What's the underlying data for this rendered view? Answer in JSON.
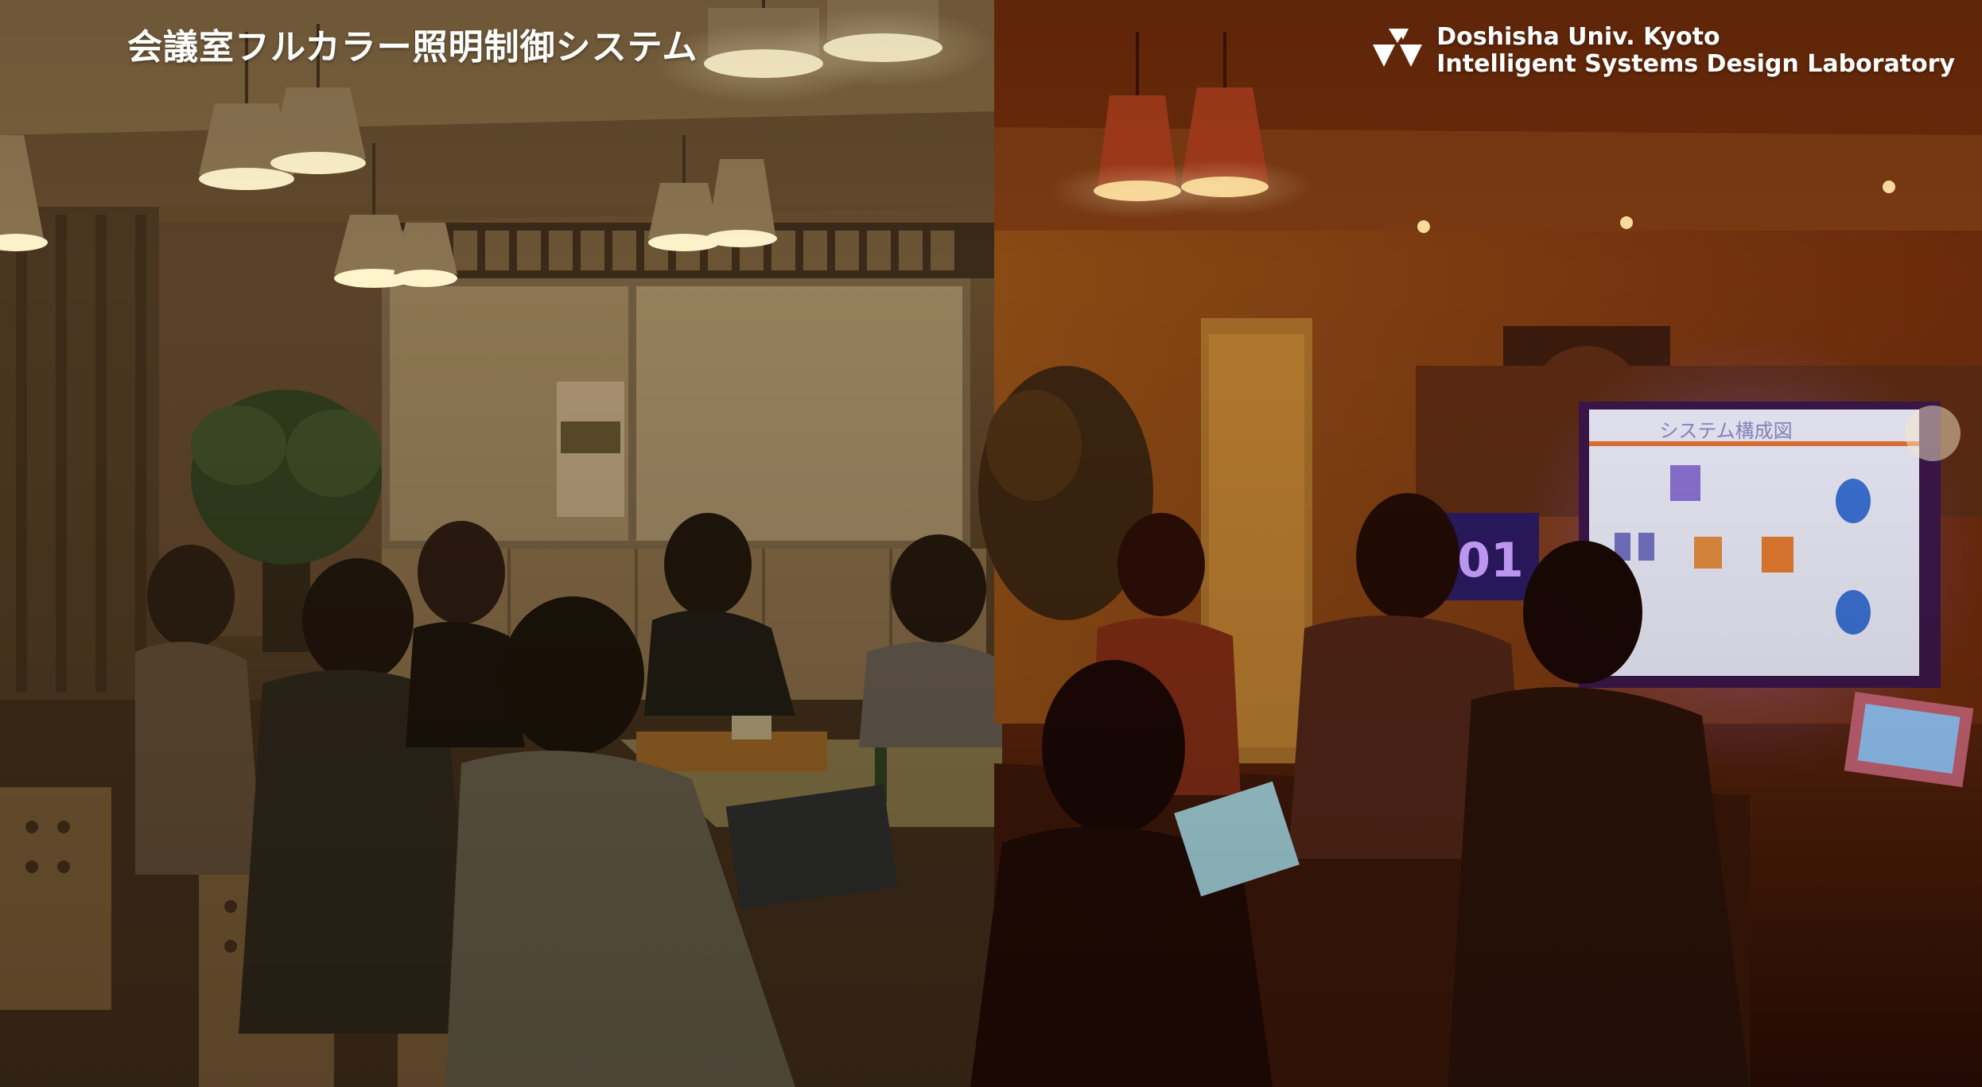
{
  "header": {
    "title": "会議室フルカラー照明制御システム",
    "lab_name_line1": "Doshisha Univ. Kyoto",
    "lab_name_line2": "Intelligent Systems Design Laboratory",
    "logo_icon": "three-triangles-logo-icon"
  },
  "scene": {
    "screen_title": "システム構成図",
    "timer_text": ":01"
  },
  "colors": {
    "left_tone": "#7a5a2e",
    "right_tone": "#8a3010",
    "text": "#ffffff"
  }
}
